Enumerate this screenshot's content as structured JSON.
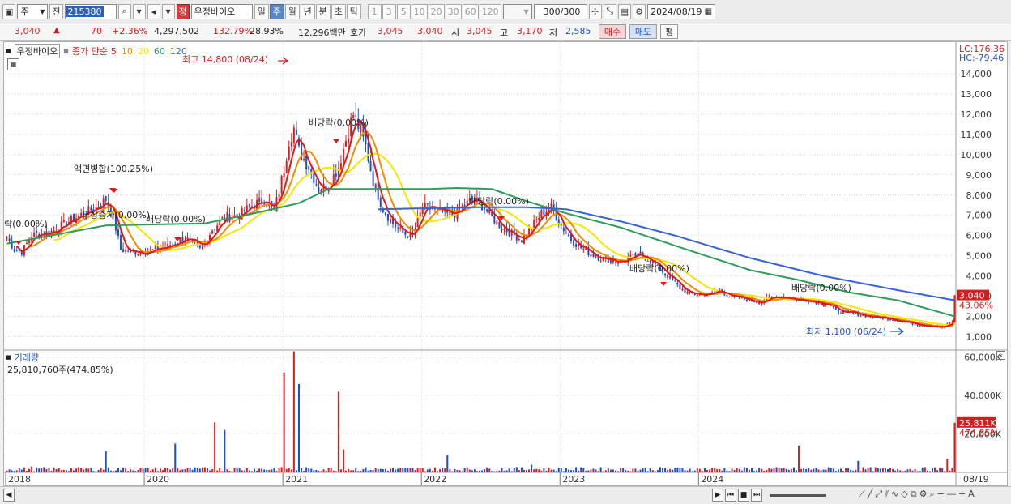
{
  "toolbar": {
    "period_dropdown": "주",
    "prev_label": "전",
    "stock_code": "215380",
    "stock_name_badge": "정",
    "stock_name": "우정바이오",
    "timeframes": [
      "일",
      "주",
      "월",
      "년",
      "분",
      "초",
      "틱"
    ],
    "active_timeframe": "주",
    "intervals": [
      "1",
      "3",
      "5",
      "10",
      "20",
      "30",
      "60",
      "120"
    ],
    "count_value": "300",
    "count_total": "/300",
    "date": "2024/08/19"
  },
  "quote": {
    "price": "3,040",
    "change": "70",
    "change_rate": "+2.36%",
    "volume": "4,297,502",
    "volume_ratio": "132.79%",
    "turnover_rate": "28.93%",
    "amount": "12,296백만",
    "bid_label": "호가",
    "bid1": "3,045",
    "bid2": "3,040",
    "open_label": "시",
    "open": "3,045",
    "high_label": "고",
    "high": "3,170",
    "low_label": "저",
    "low": "2,585",
    "buy_label": "매수",
    "sell_label": "매도",
    "eval_label": "평"
  },
  "legend": {
    "title": "우정바이오",
    "ma_label": "종가 단순",
    "periods": [
      "5",
      "10",
      "20",
      "60",
      "120"
    ]
  },
  "colors": {
    "up": "#d71f1f",
    "down": "#1c4fc8",
    "ma5": "#e01818",
    "ma10": "#f08c00",
    "ma20": "#f5e600",
    "ma60": "#2e9b5a",
    "ma120": "#3561dc",
    "grid": "#d9d9d9"
  },
  "annotations": {
    "high": "최고 14,800 (08/24)",
    "low": "최저 1,100 (06/24)",
    "events": [
      "락(0.00%)",
      "액면병합(100.25%)",
      "무상증자",
      "배당락(0.00%)",
      "배당락(0.00%)",
      "배당락(0.00%)",
      "배당락(0.00%)",
      "배당락(0.00%)",
      "배당락(0.00%)"
    ]
  },
  "right_labels": {
    "lc": "LC:176.36",
    "hc": "HC:-79.46",
    "last_price": "3,040",
    "last_pct": "43.06%",
    "last_volume": "25,811K",
    "last_volume_pct": "474.85%"
  },
  "volume_panel": {
    "title": "거래량",
    "value": "25,810,760주(474.85%)"
  },
  "chart_data": {
    "type": "candlestick",
    "price_axis_ticks": [
      "1,000",
      "2,000",
      "3,000",
      "4,000",
      "5,000",
      "6,000",
      "7,000",
      "8,000",
      "9,000",
      "10,000",
      "11,000",
      "12,000",
      "13,000",
      "14,000"
    ],
    "price_range": [
      500,
      15000
    ],
    "volume_axis_ticks": [
      "20,000K",
      "40,000K",
      "60,000K"
    ],
    "volume_range": [
      0,
      62000
    ],
    "x_labels": [
      "2018",
      "2020",
      "2021",
      "2022",
      "2023",
      "2024",
      "08/19"
    ],
    "close_points": [
      [
        0,
        5900
      ],
      [
        3,
        5300
      ],
      [
        6,
        5200
      ],
      [
        10,
        6000
      ],
      [
        18,
        6200
      ],
      [
        28,
        6900
      ],
      [
        36,
        7400
      ],
      [
        40,
        7800
      ],
      [
        43,
        6900
      ],
      [
        46,
        5300
      ],
      [
        52,
        5200
      ],
      [
        56,
        5200
      ],
      [
        60,
        5300
      ],
      [
        66,
        5500
      ],
      [
        72,
        5900
      ],
      [
        78,
        5300
      ],
      [
        83,
        6300
      ],
      [
        88,
        6900
      ],
      [
        94,
        7000
      ],
      [
        98,
        7400
      ],
      [
        104,
        7800
      ],
      [
        108,
        7200
      ],
      [
        110,
        8200
      ],
      [
        112,
        9300
      ],
      [
        114,
        10700
      ],
      [
        116,
        11300
      ],
      [
        118,
        10200
      ],
      [
        122,
        9400
      ],
      [
        126,
        8300
      ],
      [
        130,
        8500
      ],
      [
        134,
        9400
      ],
      [
        138,
        11200
      ],
      [
        140,
        12000
      ],
      [
        142,
        11400
      ],
      [
        145,
        10400
      ],
      [
        148,
        8700
      ],
      [
        152,
        7300
      ],
      [
        156,
        6600
      ],
      [
        160,
        6100
      ],
      [
        164,
        6000
      ],
      [
        168,
        7400
      ],
      [
        172,
        7300
      ],
      [
        176,
        7100
      ],
      [
        180,
        7000
      ],
      [
        184,
        7400
      ],
      [
        188,
        7800
      ],
      [
        192,
        7500
      ],
      [
        196,
        6900
      ],
      [
        200,
        6400
      ],
      [
        204,
        6100
      ],
      [
        208,
        5800
      ],
      [
        212,
        6400
      ],
      [
        216,
        7100
      ],
      [
        220,
        7400
      ],
      [
        224,
        6500
      ],
      [
        228,
        5800
      ],
      [
        232,
        5400
      ],
      [
        236,
        5100
      ],
      [
        240,
        4900
      ],
      [
        244,
        4800
      ],
      [
        248,
        4700
      ],
      [
        252,
        4900
      ],
      [
        256,
        5000
      ],
      [
        260,
        4800
      ],
      [
        264,
        4300
      ],
      [
        268,
        3900
      ],
      [
        272,
        3400
      ],
      [
        276,
        3100
      ],
      [
        280,
        3100
      ],
      [
        284,
        3100
      ],
      [
        288,
        3300
      ],
      [
        292,
        3000
      ],
      [
        296,
        2900
      ],
      [
        300,
        2800
      ],
      [
        304,
        2700
      ],
      [
        308,
        2900
      ],
      [
        312,
        3000
      ],
      [
        316,
        2900
      ],
      [
        320,
        2800
      ],
      [
        324,
        2800
      ],
      [
        328,
        2700
      ],
      [
        332,
        2600
      ],
      [
        336,
        2200
      ],
      [
        340,
        2200
      ],
      [
        344,
        2100
      ],
      [
        348,
        2000
      ],
      [
        352,
        1950
      ],
      [
        356,
        1900
      ],
      [
        360,
        1800
      ],
      [
        364,
        1700
      ],
      [
        368,
        1600
      ],
      [
        372,
        1550
      ],
      [
        376,
        1500
      ],
      [
        378,
        1450
      ],
      [
        380,
        1600
      ],
      [
        382,
        1750
      ],
      [
        383,
        3040
      ]
    ],
    "ma60_points": [
      [
        0,
        5600
      ],
      [
        40,
        6500
      ],
      [
        80,
        6600
      ],
      [
        100,
        7100
      ],
      [
        118,
        7600
      ],
      [
        130,
        8300
      ],
      [
        150,
        8300
      ],
      [
        170,
        8300
      ],
      [
        182,
        8350
      ],
      [
        196,
        8300
      ],
      [
        210,
        7700
      ],
      [
        226,
        7100
      ],
      [
        248,
        6400
      ],
      [
        270,
        5500
      ],
      [
        300,
        4300
      ],
      [
        320,
        3800
      ],
      [
        340,
        3200
      ],
      [
        360,
        2800
      ],
      [
        383,
        2000
      ]
    ],
    "ma120_points": [
      [
        150,
        7300
      ],
      [
        170,
        7350
      ],
      [
        190,
        7400
      ],
      [
        210,
        7400
      ],
      [
        226,
        7300
      ],
      [
        248,
        6700
      ],
      [
        270,
        6000
      ],
      [
        300,
        4900
      ],
      [
        330,
        4000
      ],
      [
        360,
        3300
      ],
      [
        383,
        2800
      ]
    ],
    "volume_spikes": [
      [
        10,
        3200
      ],
      [
        40,
        11000
      ],
      [
        68,
        15000
      ],
      [
        84,
        26000
      ],
      [
        88,
        22000
      ],
      [
        112,
        52000
      ],
      [
        116,
        63000
      ],
      [
        118,
        46000
      ],
      [
        134,
        42000
      ],
      [
        136,
        12000
      ],
      [
        178,
        9000
      ],
      [
        212,
        4000
      ],
      [
        320,
        14000
      ],
      [
        344,
        6000
      ],
      [
        380,
        7000
      ],
      [
        383,
        25811
      ]
    ]
  },
  "status": {
    "buttons": [
      "◀",
      "▶",
      "⏮",
      "■",
      "⏭"
    ]
  }
}
